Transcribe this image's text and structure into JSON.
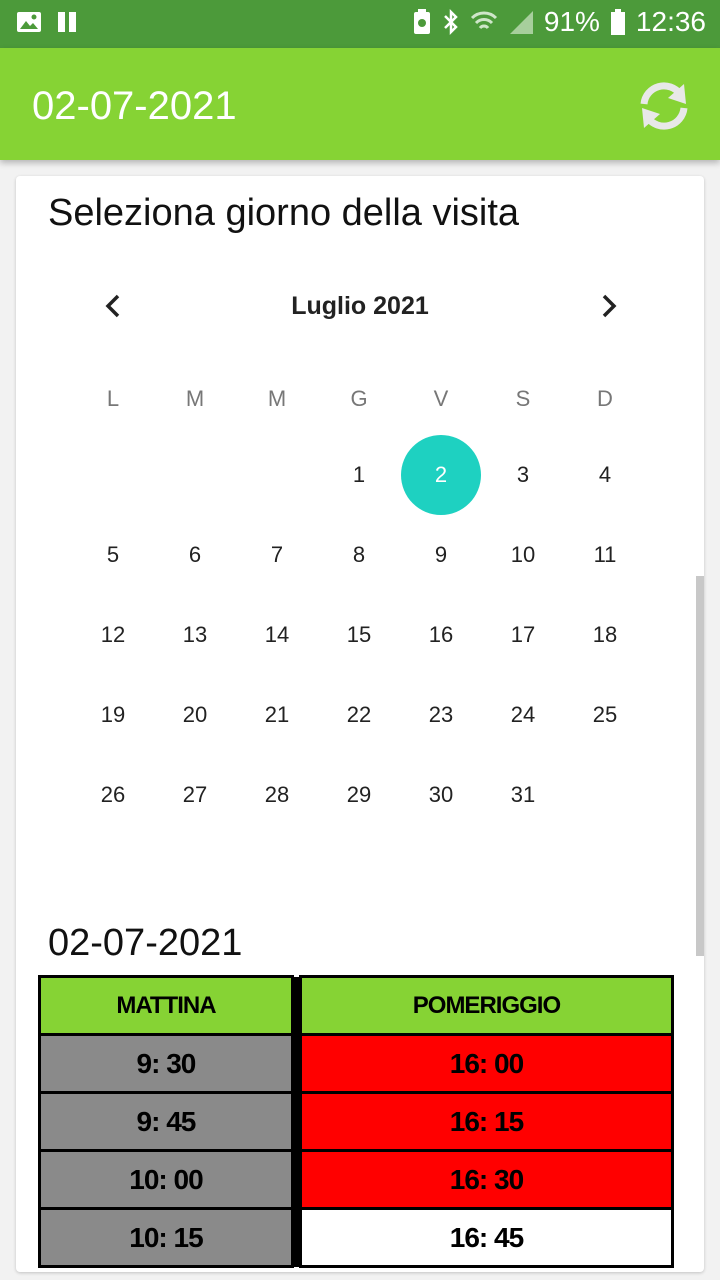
{
  "status": {
    "battery": "91%",
    "time": "12:36"
  },
  "appbar": {
    "title": "02-07-2021"
  },
  "calendar": {
    "heading": "Seleziona giorno della visita",
    "month": "Luglio 2021",
    "weekdays": [
      "L",
      "M",
      "M",
      "G",
      "V",
      "S",
      "D"
    ],
    "weeks": [
      [
        "",
        "",
        "",
        "1",
        "2",
        "3",
        "4"
      ],
      [
        "5",
        "6",
        "7",
        "8",
        "9",
        "10",
        "11"
      ],
      [
        "12",
        "13",
        "14",
        "15",
        "16",
        "17",
        "18"
      ],
      [
        "19",
        "20",
        "21",
        "22",
        "23",
        "24",
        "25"
      ],
      [
        "26",
        "27",
        "28",
        "29",
        "30",
        "31",
        ""
      ]
    ],
    "selected": "2",
    "accent": "#1ed1c1"
  },
  "schedule": {
    "date": "02-07-2021",
    "headers": [
      "MATTINA",
      "POMERIGGIO"
    ],
    "rows": [
      {
        "morning": "9: 30",
        "morning_status": "grey",
        "afternoon": "16: 00",
        "afternoon_status": "red"
      },
      {
        "morning": "9: 45",
        "morning_status": "grey",
        "afternoon": "16: 15",
        "afternoon_status": "red"
      },
      {
        "morning": "10: 00",
        "morning_status": "grey",
        "afternoon": "16: 30",
        "afternoon_status": "red"
      },
      {
        "morning": "10: 15",
        "morning_status": "grey",
        "afternoon": "16: 45",
        "afternoon_status": "white"
      }
    ]
  },
  "colors": {
    "statusbar": "#4c9a3a",
    "appbar": "#86d334",
    "busy": "#ff0000",
    "unavailable": "#8a8a8a",
    "free": "#ffffff"
  }
}
